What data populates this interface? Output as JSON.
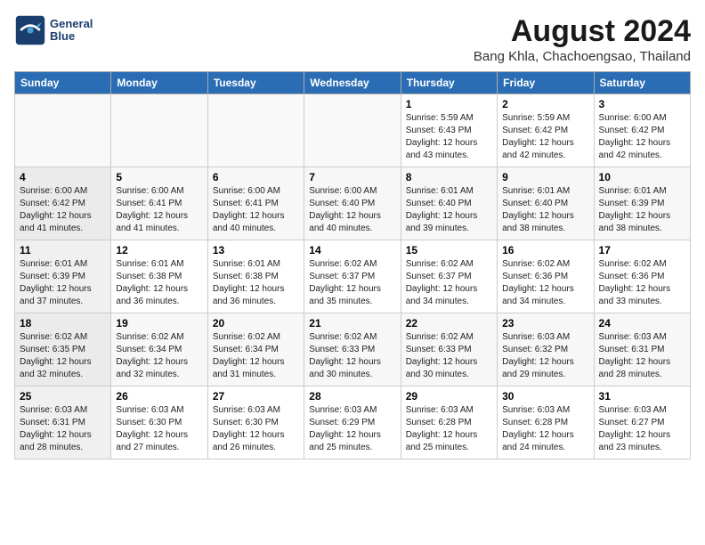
{
  "logo": {
    "line1": "General",
    "line2": "Blue"
  },
  "title": "August 2024",
  "subtitle": "Bang Khla, Chachoengsao, Thailand",
  "days_of_week": [
    "Sunday",
    "Monday",
    "Tuesday",
    "Wednesday",
    "Thursday",
    "Friday",
    "Saturday"
  ],
  "weeks": [
    [
      {
        "num": "",
        "detail": ""
      },
      {
        "num": "",
        "detail": ""
      },
      {
        "num": "",
        "detail": ""
      },
      {
        "num": "",
        "detail": ""
      },
      {
        "num": "1",
        "detail": "Sunrise: 5:59 AM\nSunset: 6:43 PM\nDaylight: 12 hours\nand 43 minutes."
      },
      {
        "num": "2",
        "detail": "Sunrise: 5:59 AM\nSunset: 6:42 PM\nDaylight: 12 hours\nand 42 minutes."
      },
      {
        "num": "3",
        "detail": "Sunrise: 6:00 AM\nSunset: 6:42 PM\nDaylight: 12 hours\nand 42 minutes."
      }
    ],
    [
      {
        "num": "4",
        "detail": "Sunrise: 6:00 AM\nSunset: 6:42 PM\nDaylight: 12 hours\nand 41 minutes."
      },
      {
        "num": "5",
        "detail": "Sunrise: 6:00 AM\nSunset: 6:41 PM\nDaylight: 12 hours\nand 41 minutes."
      },
      {
        "num": "6",
        "detail": "Sunrise: 6:00 AM\nSunset: 6:41 PM\nDaylight: 12 hours\nand 40 minutes."
      },
      {
        "num": "7",
        "detail": "Sunrise: 6:00 AM\nSunset: 6:40 PM\nDaylight: 12 hours\nand 40 minutes."
      },
      {
        "num": "8",
        "detail": "Sunrise: 6:01 AM\nSunset: 6:40 PM\nDaylight: 12 hours\nand 39 minutes."
      },
      {
        "num": "9",
        "detail": "Sunrise: 6:01 AM\nSunset: 6:40 PM\nDaylight: 12 hours\nand 38 minutes."
      },
      {
        "num": "10",
        "detail": "Sunrise: 6:01 AM\nSunset: 6:39 PM\nDaylight: 12 hours\nand 38 minutes."
      }
    ],
    [
      {
        "num": "11",
        "detail": "Sunrise: 6:01 AM\nSunset: 6:39 PM\nDaylight: 12 hours\nand 37 minutes."
      },
      {
        "num": "12",
        "detail": "Sunrise: 6:01 AM\nSunset: 6:38 PM\nDaylight: 12 hours\nand 36 minutes."
      },
      {
        "num": "13",
        "detail": "Sunrise: 6:01 AM\nSunset: 6:38 PM\nDaylight: 12 hours\nand 36 minutes."
      },
      {
        "num": "14",
        "detail": "Sunrise: 6:02 AM\nSunset: 6:37 PM\nDaylight: 12 hours\nand 35 minutes."
      },
      {
        "num": "15",
        "detail": "Sunrise: 6:02 AM\nSunset: 6:37 PM\nDaylight: 12 hours\nand 34 minutes."
      },
      {
        "num": "16",
        "detail": "Sunrise: 6:02 AM\nSunset: 6:36 PM\nDaylight: 12 hours\nand 34 minutes."
      },
      {
        "num": "17",
        "detail": "Sunrise: 6:02 AM\nSunset: 6:36 PM\nDaylight: 12 hours\nand 33 minutes."
      }
    ],
    [
      {
        "num": "18",
        "detail": "Sunrise: 6:02 AM\nSunset: 6:35 PM\nDaylight: 12 hours\nand 32 minutes."
      },
      {
        "num": "19",
        "detail": "Sunrise: 6:02 AM\nSunset: 6:34 PM\nDaylight: 12 hours\nand 32 minutes."
      },
      {
        "num": "20",
        "detail": "Sunrise: 6:02 AM\nSunset: 6:34 PM\nDaylight: 12 hours\nand 31 minutes."
      },
      {
        "num": "21",
        "detail": "Sunrise: 6:02 AM\nSunset: 6:33 PM\nDaylight: 12 hours\nand 30 minutes."
      },
      {
        "num": "22",
        "detail": "Sunrise: 6:02 AM\nSunset: 6:33 PM\nDaylight: 12 hours\nand 30 minutes."
      },
      {
        "num": "23",
        "detail": "Sunrise: 6:03 AM\nSunset: 6:32 PM\nDaylight: 12 hours\nand 29 minutes."
      },
      {
        "num": "24",
        "detail": "Sunrise: 6:03 AM\nSunset: 6:31 PM\nDaylight: 12 hours\nand 28 minutes."
      }
    ],
    [
      {
        "num": "25",
        "detail": "Sunrise: 6:03 AM\nSunset: 6:31 PM\nDaylight: 12 hours\nand 28 minutes."
      },
      {
        "num": "26",
        "detail": "Sunrise: 6:03 AM\nSunset: 6:30 PM\nDaylight: 12 hours\nand 27 minutes."
      },
      {
        "num": "27",
        "detail": "Sunrise: 6:03 AM\nSunset: 6:30 PM\nDaylight: 12 hours\nand 26 minutes."
      },
      {
        "num": "28",
        "detail": "Sunrise: 6:03 AM\nSunset: 6:29 PM\nDaylight: 12 hours\nand 25 minutes."
      },
      {
        "num": "29",
        "detail": "Sunrise: 6:03 AM\nSunset: 6:28 PM\nDaylight: 12 hours\nand 25 minutes."
      },
      {
        "num": "30",
        "detail": "Sunrise: 6:03 AM\nSunset: 6:28 PM\nDaylight: 12 hours\nand 24 minutes."
      },
      {
        "num": "31",
        "detail": "Sunrise: 6:03 AM\nSunset: 6:27 PM\nDaylight: 12 hours\nand 23 minutes."
      }
    ]
  ]
}
